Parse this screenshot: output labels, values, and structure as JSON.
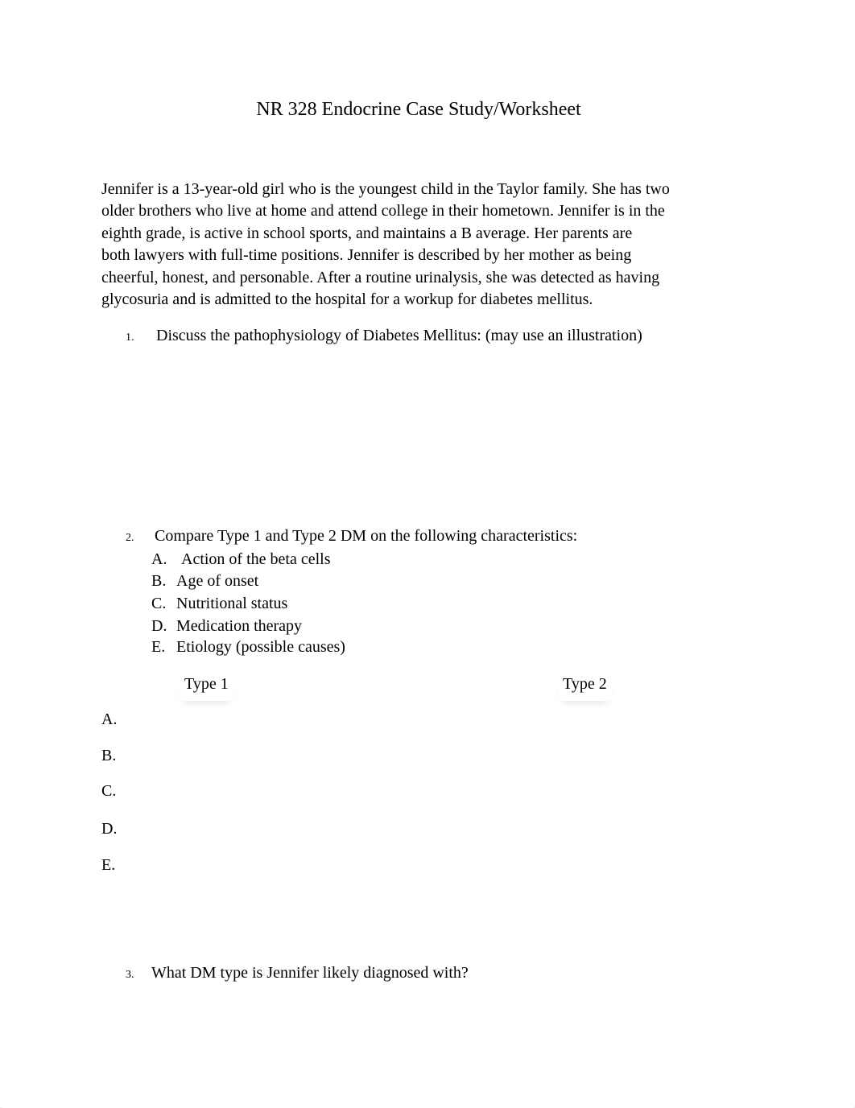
{
  "document": {
    "title": "NR 328 Endocrine Case Study/Worksheet",
    "intro_lines": [
      "Jennifer is a 13-year-old girl who is the youngest child in the Taylor family. She has two",
      "older brothers who live at home and attend college in their hometown. Jennifer is in the",
      "eighth grade, is active in school sports, and maintains a B average. Her parents are",
      "both lawyers with full-time positions. Jennifer is described by her mother as being",
      "cheerful, honest, and personable. After a routine urinalysis, she was detected as having",
      "glycosuria and is admitted to the hospital for a workup for diabetes mellitus."
    ],
    "questions": [
      {
        "number": "1.",
        "text": "Discuss the pathophysiology of  Diabetes Mellitus: (may use an illustration)"
      },
      {
        "number": "2.",
        "text": "Compare Type 1 and Type 2 DM on the following characteristics:",
        "sub_items": [
          {
            "letter": "A.",
            "text": "Action of the beta cells"
          },
          {
            "letter": "B.",
            "text": "Age of onset"
          },
          {
            "letter": "C.",
            "text": "Nutritional status"
          },
          {
            "letter": "D.",
            "text": "Medication therapy"
          },
          {
            "letter": "E.",
            "text": "Etiology (possible causes)"
          }
        ],
        "comparison_table": {
          "columns": [
            "Type 1",
            "Type 2"
          ],
          "rows": [
            "A.",
            "B.",
            "C.",
            "D.",
            "E."
          ]
        }
      },
      {
        "number": "3.",
        "text": "What DM type is Jennifer likely diagnosed with?"
      }
    ]
  }
}
